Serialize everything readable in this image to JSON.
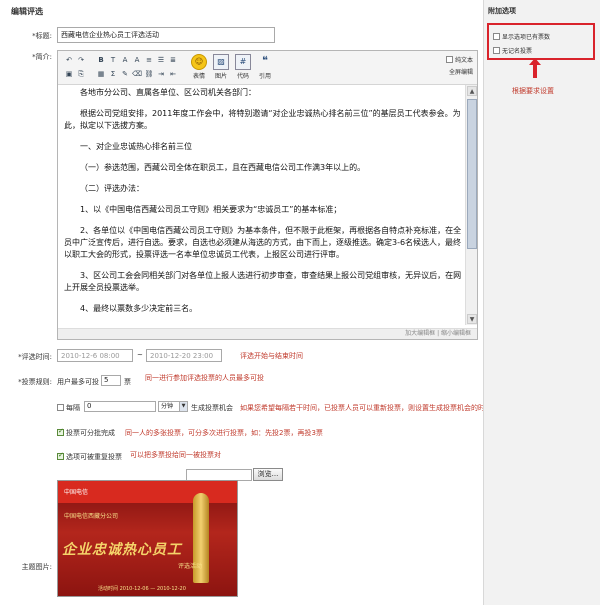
{
  "page": {
    "title": "编辑评选"
  },
  "form": {
    "title_label": "*标题:",
    "title_value": "西藏电信企业热心员工评选活动",
    "intro_label": "*简介:",
    "time_label": "*评选时间:",
    "start_date": "2010-12-6 08:00",
    "end_date": "2010-12-20 23:00",
    "tilde": "~",
    "time_note": "评选开始与结束时间",
    "rule_label": "*投票规则:",
    "rule_prefix": "用户最多可投",
    "rule_value": "5",
    "rule_suffix": "票",
    "rule_note": "同一进行参加评选投票的人员最多可投",
    "interval_label": "每隔",
    "interval_value": "0",
    "interval_unit": "分钟",
    "interval_suffix": "生成投票机会",
    "interval_note": "如果您希望每隔若干时间，已投票人员可以重新投票，则设置生成投票机会的时间间隔",
    "split_label": "投票可分批完成",
    "split_note": "同一人的多张投票，可分多次进行投票，如：先投2票，再投3票",
    "repeat_label": "选项可被重复投票",
    "repeat_note": "可以把多票投给同一被投票对",
    "image_label": "主题图片:",
    "browse_label": "浏览..."
  },
  "toolbar": {
    "buttons": {
      "emoticon": "表情",
      "image": "图片",
      "code": "代码",
      "quote": "引用"
    },
    "plain_text": "纯文本",
    "fullscreen": "全屏编辑",
    "resize": "加大编辑框 | 缩小编辑框"
  },
  "editor": {
    "paragraphs": [
      "各地市分公司、直属各单位、区公司机关各部门：",
      "根据公司党组安排，2011年度工作会中，将特别邀请“对企业忠诚热心排名前三位”的基层员工代表参会。为此，拟定以下选拔方案。",
      "一、对企业忠诚热心排名前三位",
      "（一）参选范围，西藏公司全体在职员工，且在西藏电信公司工作满3年以上的。",
      "（二）评选办法：",
      "1、以《中国电信西藏公司员工守则》相关要求为“忠诚员工”的基本标准；",
      "2、各单位以《中国电信西藏公司员工守则》为基本条件，但不限于此框架，再根据各自特点补充标准，在全员中广泛宣传后，进行自选。要求，自选也必须建从海选的方式，由下而上，逐级推选。确定3-6名候选人，最终以职工大会的形式，投票评选一名本单位忠诚员工代表，上报区公司进行评审。",
      "3、区公司工会会同相关部门对各单位上报人选进行初步审查，审查结果上报公司党组审核，无异议后，在网上开展全员投票选举。",
      "4、最终以票数多少决定前三名。"
    ]
  },
  "banner": {
    "logo": "中国电信",
    "company": "中国电信西藏分公司",
    "headline": "企业忠诚热心员工",
    "sub": "评选活动",
    "foot": "活动时间 2010-12-06 — 2010-12-20"
  },
  "addon": {
    "title": "附加选项",
    "items": [
      "显示选项已有票数",
      "无记名投票"
    ],
    "annotation": "根据要求设置"
  }
}
